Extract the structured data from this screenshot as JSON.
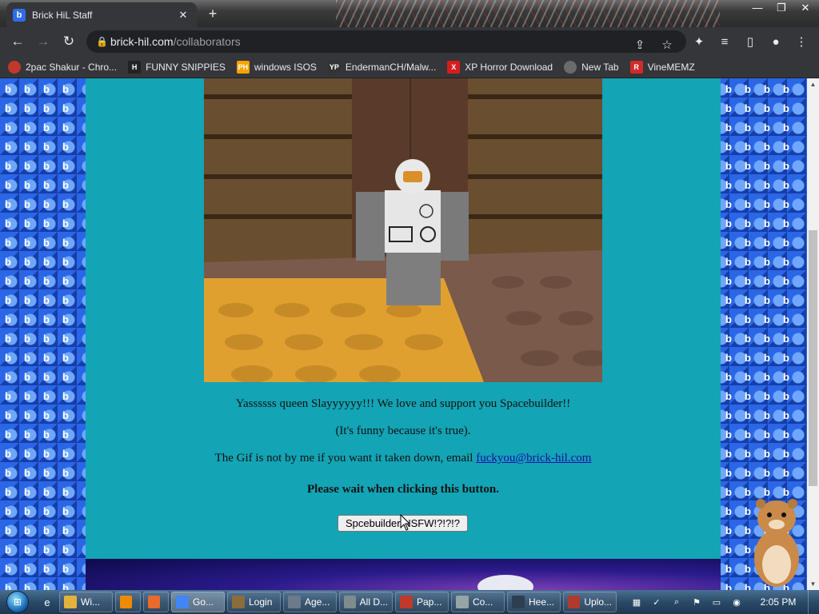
{
  "browser": {
    "tab": {
      "title": "Brick HiL Staff",
      "favicon": "b"
    },
    "url": {
      "host": "brick-hil.com",
      "path": "/collaborators"
    }
  },
  "bookmarks": [
    {
      "label": "2pac Shakur - Chro...",
      "icon": "2pac-icon",
      "badge": "",
      "color": "#c0392b"
    },
    {
      "label": "FUNNY SNIPPIES",
      "icon": "h-icon",
      "badge": "H",
      "color": "#222222"
    },
    {
      "label": "windows ISOS",
      "icon": "ph-icon",
      "badge": "PH",
      "color": "#f7a300"
    },
    {
      "label": "EndermanCH/Malw...",
      "icon": "yp-icon",
      "badge": "YP",
      "color": "#333333"
    },
    {
      "label": "XP Horror Download",
      "icon": "x-icon",
      "badge": "X",
      "color": "#d81c1c"
    },
    {
      "label": "New Tab",
      "icon": "newtab-icon",
      "badge": "",
      "color": "#6b6b6b"
    },
    {
      "label": "VineMEMZ",
      "icon": "r-icon",
      "badge": "R",
      "color": "#d22a2a"
    }
  ],
  "page": {
    "line1": "Yassssss queen Slayyyyyy!!! We love and support you Spacebuilder!!",
    "line2": "(It's funny because it's true).",
    "line3_text": "The Gif is not by me if you want it taken down, email ",
    "line3_link": "fuckyou@brick-hil.com",
    "notice": "Please wait when clicking this button.",
    "button": "Spcebuilder NSFW!?!?!?"
  },
  "taskbar": {
    "items": [
      {
        "label": "Wi...",
        "icon": "explorer-icon",
        "color": "#e3b23c"
      },
      {
        "label": "",
        "icon": "media-player-icon",
        "color": "#f08a00"
      },
      {
        "label": "",
        "icon": "gallery-icon",
        "color": "#e96a2a"
      },
      {
        "label": "Go...",
        "icon": "chrome-icon",
        "color": "#4285f4",
        "active": true
      },
      {
        "label": "Login",
        "icon": "login-icon",
        "color": "#8a6d3b"
      },
      {
        "label": "Age...",
        "icon": "window-icon",
        "color": "#6c7a89"
      },
      {
        "label": "All D...",
        "icon": "folder-window-icon",
        "color": "#7f8c8d"
      },
      {
        "label": "Pap...",
        "icon": "paper-icon",
        "color": "#c0392b"
      },
      {
        "label": "Co...",
        "icon": "config-icon",
        "color": "#95a5a6"
      },
      {
        "label": "Hee...",
        "icon": "app-icon",
        "color": "#2c3e50"
      },
      {
        "label": "Uplo...",
        "icon": "upload-icon",
        "color": "#b03a2e"
      }
    ],
    "clock": "2:05 PM"
  }
}
